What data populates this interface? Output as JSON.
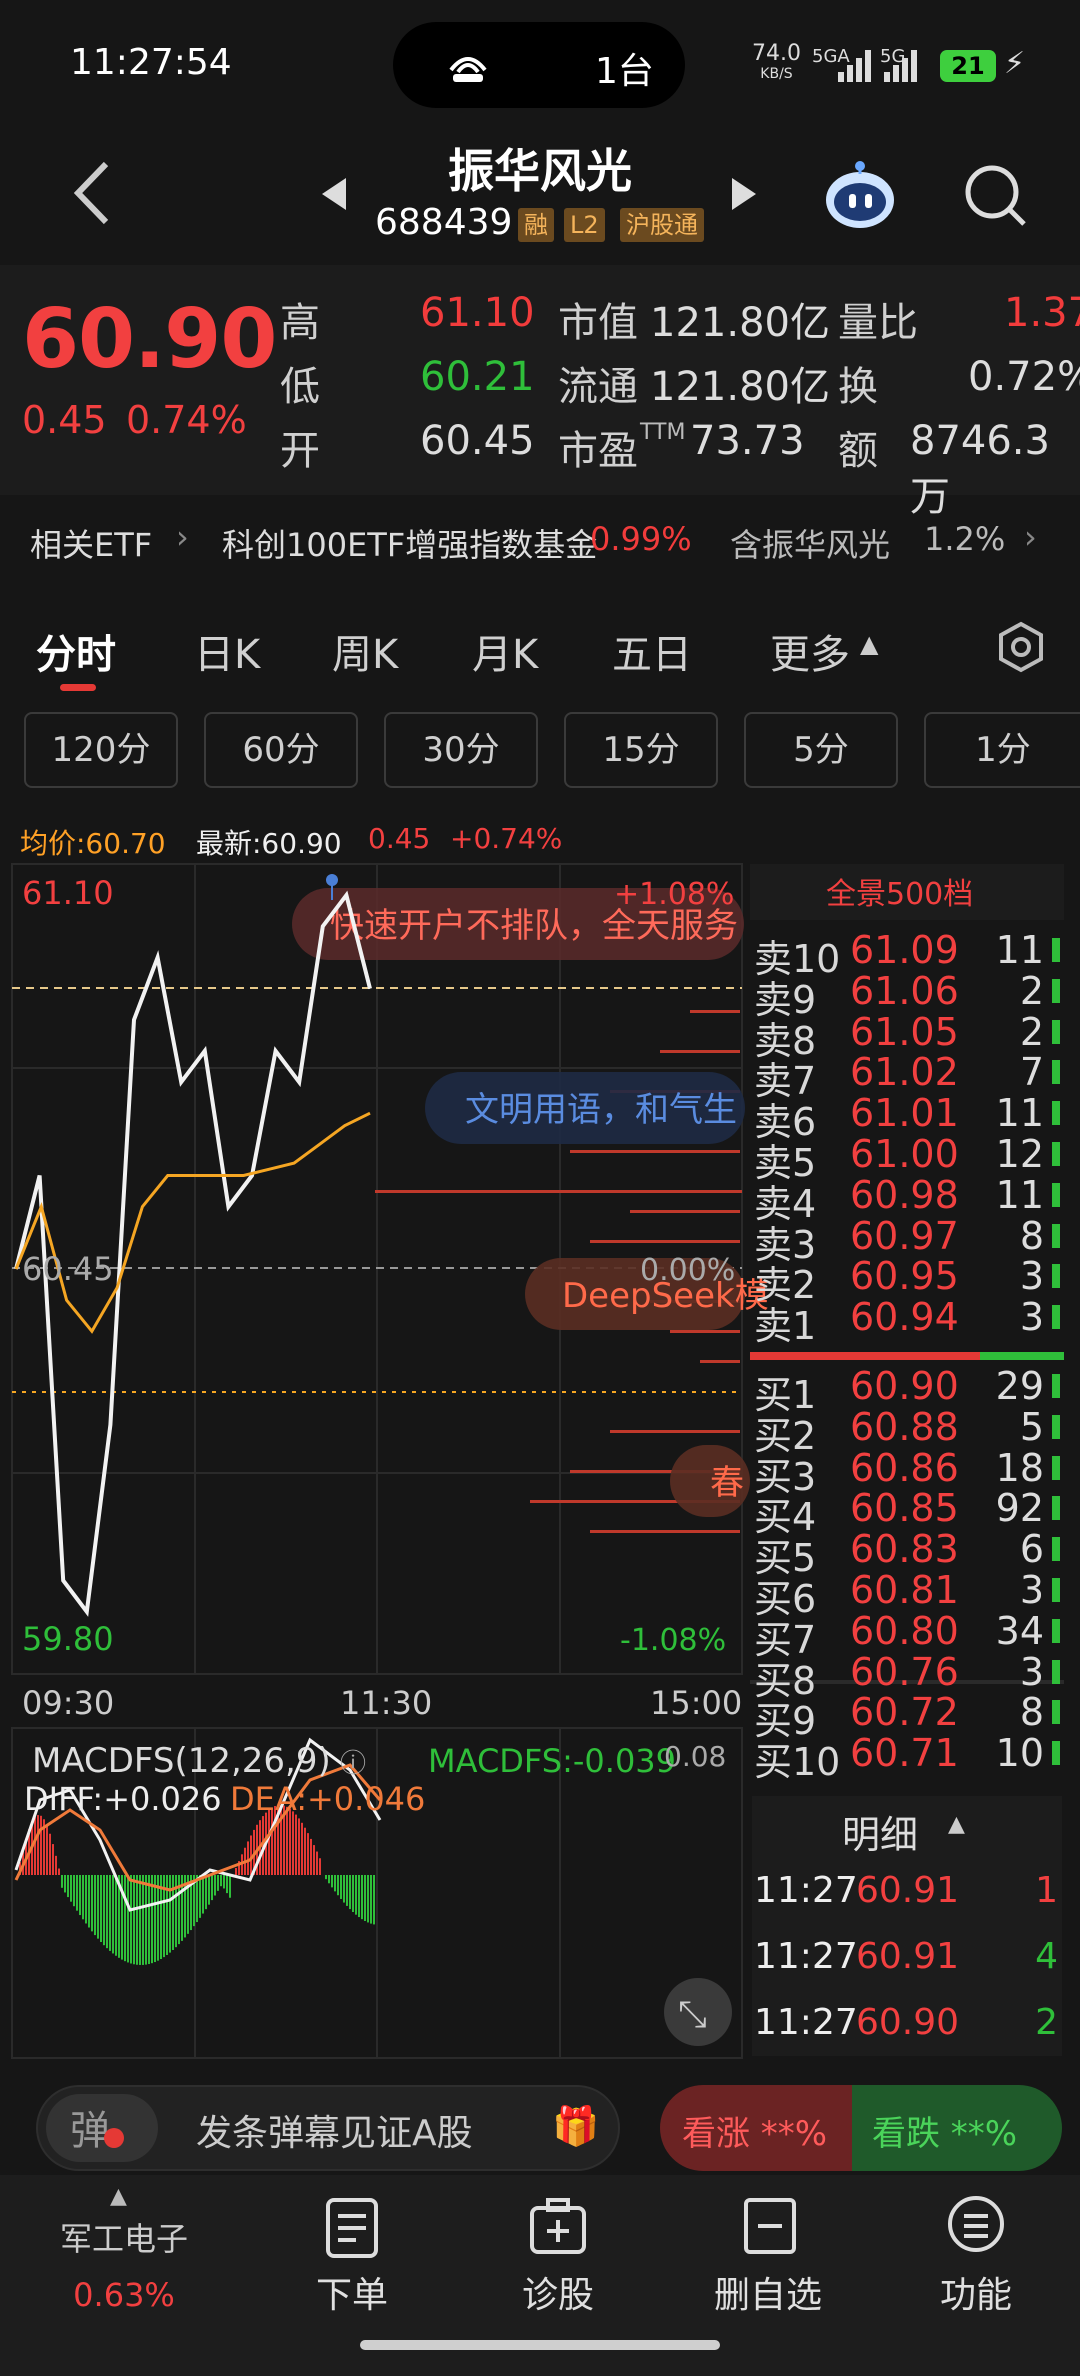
{
  "status": {
    "time": "11:27:54",
    "island_text": "1台",
    "net_speed": "74.0",
    "net_unit": "KB/S",
    "sig1": "5GA",
    "sig2": "5G",
    "battery": "21"
  },
  "nav": {
    "name": "振华风光",
    "code": "688439",
    "tags": [
      "融",
      "L2",
      "沪股通"
    ]
  },
  "quote": {
    "price": "60.90",
    "change": "0.45",
    "change_pct": "0.74%",
    "high_label": "高",
    "high": "61.10",
    "low_label": "低",
    "low": "60.21",
    "open_label": "开",
    "open": "60.45",
    "mcap_label": "市值",
    "mcap": "121.80亿",
    "float_label": "流通",
    "float": "121.80亿",
    "pe_label": "市盈",
    "pe_sup": "TTM",
    "pe": "73.73",
    "vr_label": "量比",
    "vr": "1.37",
    "turn_label": "换",
    "turn": "0.72%",
    "amt_label": "额",
    "amt": "8746.3万"
  },
  "etf": {
    "label": "相关ETF",
    "name": "科创100ETF增强指数基金",
    "pct": "0.99%",
    "holding": "含振华风光",
    "holding_pct": "1.2%"
  },
  "tabs": [
    "分时",
    "日K",
    "周K",
    "月K",
    "五日",
    "更多"
  ],
  "ktabs": [
    "120分",
    "60分",
    "30分",
    "15分",
    "5分",
    "1分"
  ],
  "info": {
    "avg": "均价:60.70",
    "latest": "最新:60.90",
    "chg": "0.45",
    "pct": "+0.74%"
  },
  "chart": {
    "y_top": "61.10",
    "y_mid": "60.45",
    "y_bot": "59.80",
    "pct_top": "+1.08%",
    "pct_mid": "0.00%",
    "pct_bot": "-1.08%",
    "x_labels": [
      "09:30",
      "11:30",
      "15:00"
    ],
    "danmu": [
      "快速开户不排队，全天服务",
      "文明用语，和气生",
      "DeepSeek模",
      "春"
    ],
    "macd_title": "MACDFS(12,26,9)",
    "macd_val": "MACDFS:-0.039",
    "diff": "DIFF:+0.026",
    "dea": "DEA:+0.046",
    "macd_axis": "0.08"
  },
  "chart_data": {
    "type": "line",
    "title": "",
    "x_labels": [
      "09:30",
      "11:30",
      "15:00"
    ],
    "ylim": [
      59.8,
      61.1
    ],
    "series": [
      {
        "values": [
          60.45,
          60.6,
          59.95,
          59.9,
          60.2,
          60.85,
          60.95,
          60.75,
          60.8,
          60.55,
          60.6,
          60.8,
          60.75,
          61.0,
          61.05,
          60.9
        ]
      },
      {
        "values": [
          60.45,
          60.55,
          60.4,
          60.35,
          60.42,
          60.55,
          60.6,
          60.6,
          60.6,
          60.6,
          60.61,
          60.62,
          60.65,
          60.68,
          60.7
        ]
      }
    ]
  },
  "orderbook": {
    "title": "全景500档",
    "asks": [
      {
        "l": "卖10",
        "p": "61.09",
        "v": "11"
      },
      {
        "l": "卖9",
        "p": "61.06",
        "v": "2"
      },
      {
        "l": "卖8",
        "p": "61.05",
        "v": "2"
      },
      {
        "l": "卖7",
        "p": "61.02",
        "v": "7"
      },
      {
        "l": "卖6",
        "p": "61.01",
        "v": "11"
      },
      {
        "l": "卖5",
        "p": "61.00",
        "v": "12"
      },
      {
        "l": "卖4",
        "p": "60.98",
        "v": "11"
      },
      {
        "l": "卖3",
        "p": "60.97",
        "v": "8"
      },
      {
        "l": "卖2",
        "p": "60.95",
        "v": "3"
      },
      {
        "l": "卖1",
        "p": "60.94",
        "v": "3"
      }
    ],
    "bids": [
      {
        "l": "买1",
        "p": "60.90",
        "v": "29"
      },
      {
        "l": "买2",
        "p": "60.88",
        "v": "5"
      },
      {
        "l": "买3",
        "p": "60.86",
        "v": "18"
      },
      {
        "l": "买4",
        "p": "60.85",
        "v": "92"
      },
      {
        "l": "买5",
        "p": "60.83",
        "v": "6"
      },
      {
        "l": "买6",
        "p": "60.81",
        "v": "3"
      },
      {
        "l": "买7",
        "p": "60.80",
        "v": "34"
      },
      {
        "l": "买8",
        "p": "60.76",
        "v": "3"
      },
      {
        "l": "买9",
        "p": "60.72",
        "v": "8"
      },
      {
        "l": "买10",
        "p": "60.71",
        "v": "10"
      }
    ]
  },
  "detail": {
    "title": "明细",
    "rows": [
      {
        "t": "11:27",
        "p": "60.91",
        "v": "1"
      },
      {
        "t": "11:27",
        "p": "60.91",
        "v": "4"
      },
      {
        "t": "11:27",
        "p": "60.90",
        "v": "2"
      }
    ]
  },
  "bottom": {
    "danmu_icon": "弹",
    "danmu_placeholder": "发条弹幕见证A股",
    "rise": "看涨 **%",
    "fall": "看跌 **%",
    "sector": "军工电子",
    "sector_pct": "0.63%",
    "tabs": [
      "下单",
      "诊股",
      "删自选",
      "功能"
    ]
  }
}
